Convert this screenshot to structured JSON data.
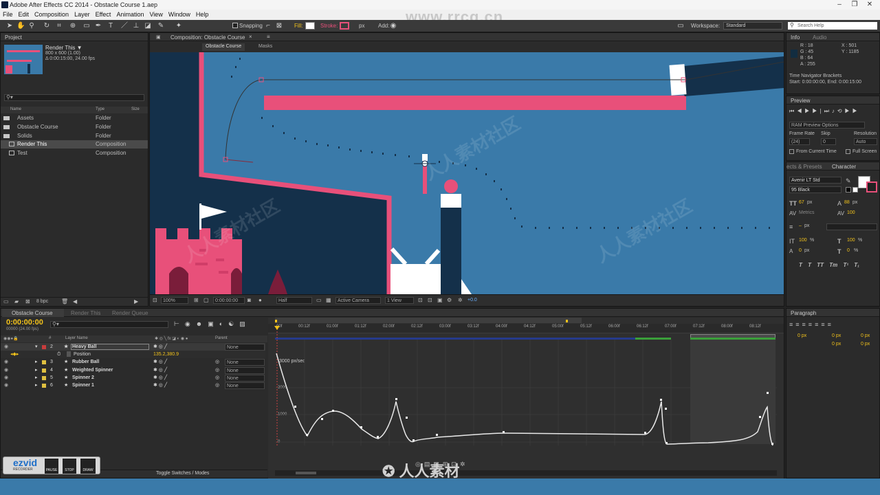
{
  "window": {
    "title": "Adobe After Effects CC 2014 - Obstacle Course 1.aep",
    "minimize": "–",
    "restore": "❐",
    "close": "✕"
  },
  "menu": [
    "File",
    "Edit",
    "Composition",
    "Layer",
    "Effect",
    "Animation",
    "View",
    "Window",
    "Help"
  ],
  "toolbar": {
    "snapping": "Snapping",
    "fill": "Fill:",
    "stroke": "Stroke:",
    "stroke_unit": "px",
    "add": "Add:",
    "workspace_label": "Workspace:",
    "workspace_value": "Standard",
    "search_placeholder": "Search Help"
  },
  "watermark_url": "www.rrcg.cn",
  "project": {
    "tab": "Project",
    "thumb_name": "Render This ▼",
    "thumb_info1": "800 x 600 (1.00)",
    "thumb_info2": "Δ 0:00:15:00, 24.00 fps",
    "col_name": "Name",
    "col_type": "Type",
    "col_size": "Size",
    "items": [
      {
        "name": "Assets",
        "type": "Folder"
      },
      {
        "name": "Obstacle Course",
        "type": "Folder"
      },
      {
        "name": "Solids",
        "type": "Folder"
      },
      {
        "name": "Render This",
        "type": "Composition"
      },
      {
        "name": "Test",
        "type": "Composition"
      }
    ],
    "bpc": "8 bpc"
  },
  "composition": {
    "tab": "Composition: Obstacle Course",
    "subtab": "Obstacle Course",
    "masks": "Masks",
    "zoom": "100%",
    "timecode": "0:00:00:00",
    "resolution": "Half",
    "camera": "Active Camera",
    "views": "1 View",
    "exposure": "+0.0"
  },
  "info": {
    "tab": "Info",
    "tab2": "Audio",
    "r": "R : 18",
    "g": "G : 45",
    "b": "B : 64",
    "a": "A : 255",
    "x": "X : 501",
    "y": "Y : 1185",
    "nav_title": "Time Navigator Brackets",
    "nav_range": "Start: 0:00:00:00, End: 0:00:15:00"
  },
  "preview": {
    "tab": "Preview",
    "ram": "RAM Preview Options",
    "frame_rate_label": "Frame Rate",
    "skip_label": "Skip",
    "resolution_label": "Resolution",
    "frame_rate": "(24)",
    "skip": "0",
    "resolution": "Auto",
    "from_current": "From Current Time",
    "full_screen": "Full Screen"
  },
  "character": {
    "tab1": "ects & Presets",
    "tab2": "Character",
    "font": "Avenir LT Std",
    "style": "95 Black",
    "size": "67",
    "size_unit": "px",
    "leading": "88",
    "leading_unit": "px",
    "tracking_label": "Metrics",
    "tracking": "100",
    "stroke_w": "–",
    "stroke_unit": "px",
    "vscale": "100",
    "hscale": "100",
    "baseline": "0",
    "baseline_unit": "px",
    "tsume": "0",
    "pct": "%",
    "styles": [
      "T",
      "T",
      "TT",
      "Tт",
      "T¹",
      "T₁"
    ]
  },
  "paragraph": {
    "tab": "Paragraph",
    "v1": "0 px",
    "v2": "0 px",
    "v3": "0 px",
    "v4": "0 px",
    "v5": "0 px"
  },
  "timeline": {
    "tabs": [
      "Obstacle Course",
      "Render This",
      "Render Queue"
    ],
    "timecode": "0:00:00:00",
    "fps": "00000 (24.00 fps)",
    "col_layer": "Layer Name",
    "col_parent": "Parent",
    "toggle": "Toggle Switches / Modes",
    "graph_unit": "3000 px/sec",
    "graph_ticks": [
      "2000",
      "1000",
      "0"
    ],
    "ruler": [
      "00f",
      "00:12f",
      "01:00f",
      "01:12f",
      "02:00f",
      "02:12f",
      "03:00f",
      "03:12f",
      "04:00f",
      "04:12f",
      "05:00f",
      "05:12f",
      "06:00f",
      "06:12f",
      "07:00f",
      "07:12f",
      "08:00f",
      "08:12f"
    ],
    "layers": [
      {
        "num": "2",
        "name": "Heavy Ball",
        "parent": "None",
        "color": "#c83c3c"
      },
      {
        "num": "3",
        "name": "Rubber Ball",
        "parent": "None",
        "color": "#e0c040"
      },
      {
        "num": "4",
        "name": "Weighted Spinner",
        "parent": "None",
        "color": "#e0c040"
      },
      {
        "num": "5",
        "name": "Spinner 2",
        "parent": "None",
        "color": "#e0c040"
      },
      {
        "num": "6",
        "name": "Spinner 1",
        "parent": "None",
        "color": "#e0c040"
      }
    ],
    "property": "Position",
    "property_value": "135.2,380.9"
  },
  "recorder": {
    "logo": "ezvid",
    "sub": "RECORDER",
    "pause": "PAUSE",
    "stop": "STOP",
    "draw": "DRAW"
  },
  "colors": {
    "accent": "#f2c21b",
    "pink": "#e8507a",
    "navy": "#14304a",
    "bg_blue": "#3a7aa9"
  }
}
